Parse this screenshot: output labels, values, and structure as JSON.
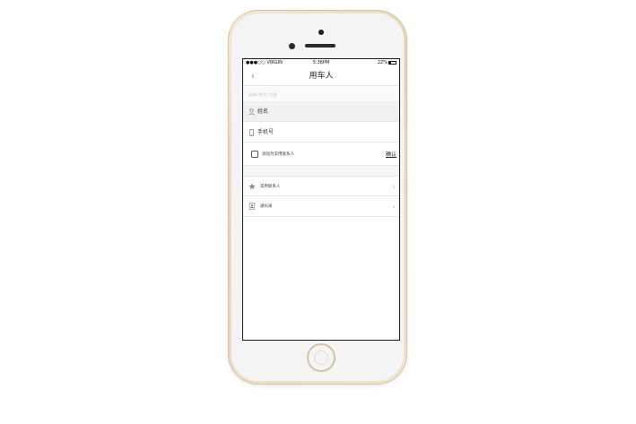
{
  "status_bar": {
    "carrier": "●●●○○ VIRGIN",
    "time": "5:36PM",
    "battery": "22%"
  },
  "nav": {
    "back_icon": "‹",
    "title": "用车人"
  },
  "search": {
    "placeholder": "请输入姓名人名查"
  },
  "form": {
    "name_label": "姓名",
    "phone_label": "手机号",
    "save_contact_label": "添加为常用联系人",
    "confirm_label": "确认"
  },
  "list": {
    "favorites_label": "常用联系人",
    "contacts_label": "通讯录",
    "chevron": "›"
  },
  "colors": {
    "phone_body": "#e8d7bb",
    "screen_bg": "#ffffff",
    "name_row_bg": "#f1f1f1"
  }
}
